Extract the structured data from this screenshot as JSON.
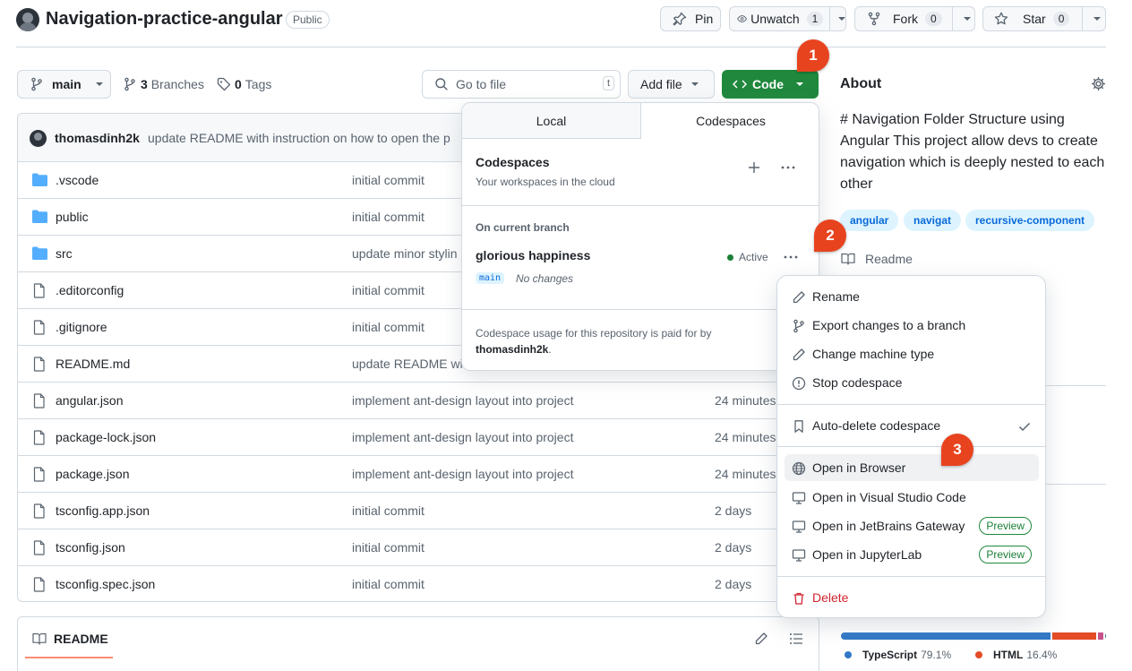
{
  "repo": {
    "name": "Navigation-practice-angular",
    "visibility": "Public"
  },
  "header_actions": {
    "pin": "Pin",
    "unwatch": "Unwatch",
    "unwatch_count": "1",
    "fork": "Fork",
    "fork_count": "0",
    "star": "Star",
    "star_count": "0"
  },
  "toolbar": {
    "branch": "main",
    "branches_count": "3",
    "branches_label": "Branches",
    "tags_count": "0",
    "tags_label": "Tags",
    "go_to_file_placeholder": "Go to file",
    "go_to_file_shortcut": "t",
    "add_file": "Add file",
    "code": "Code"
  },
  "latest_commit": {
    "author": "thomasdinh2k",
    "message": "update README with instruction on how to open the p"
  },
  "files": [
    {
      "name": ".vscode",
      "type": "folder",
      "message": "initial commit",
      "time": ""
    },
    {
      "name": "public",
      "type": "folder",
      "message": "initial commit",
      "time": ""
    },
    {
      "name": "src",
      "type": "folder",
      "message": "update minor stylin",
      "time": ""
    },
    {
      "name": ".editorconfig",
      "type": "file",
      "message": "initial commit",
      "time": ""
    },
    {
      "name": ".gitignore",
      "type": "file",
      "message": "initial commit",
      "time": ""
    },
    {
      "name": "README.md",
      "type": "file",
      "message": "update README wi",
      "time": ""
    },
    {
      "name": "angular.json",
      "type": "file",
      "message": "implement ant-design layout into project",
      "time": "24 minutes"
    },
    {
      "name": "package-lock.json",
      "type": "file",
      "message": "implement ant-design layout into project",
      "time": "24 minutes"
    },
    {
      "name": "package.json",
      "type": "file",
      "message": "implement ant-design layout into project",
      "time": "24 minutes"
    },
    {
      "name": "tsconfig.app.json",
      "type": "file",
      "message": "initial commit",
      "time": "2 days"
    },
    {
      "name": "tsconfig.json",
      "type": "file",
      "message": "initial commit",
      "time": "2 days"
    },
    {
      "name": "tsconfig.spec.json",
      "type": "file",
      "message": "initial commit",
      "time": "2 days"
    }
  ],
  "readme_header": {
    "title": "README"
  },
  "about": {
    "title": "About",
    "description": "# Navigation Folder Structure using Angular This project allow devs to create navigation which is deeply nested to each other",
    "topics": [
      "angular",
      "navigat",
      "recursive-component"
    ],
    "readme_link": "Readme"
  },
  "languages": [
    {
      "name": "TypeScript",
      "percent": "79.1%",
      "color": "#3178c6",
      "fraction": 0.791
    },
    {
      "name": "HTML",
      "percent": "16.4%",
      "color": "#e34c26",
      "fraction": 0.164
    }
  ],
  "code_popup": {
    "tab_local": "Local",
    "tab_codespaces": "Codespaces",
    "section_title": "Codespaces",
    "section_subtitle": "Your workspaces in the cloud",
    "branch_heading": "On current branch",
    "codespace_name": "glorious happiness",
    "status": "Active",
    "status_color": "#1a7f37",
    "branch_tag": "main",
    "changes": "No changes",
    "footer_text": "Codespace usage for this repository is paid for by",
    "footer_owner": "thomasdinh2k",
    "footer_end": "."
  },
  "context_menu": {
    "rename": "Rename",
    "export": "Export changes to a branch",
    "change_machine": "Change machine type",
    "stop": "Stop codespace",
    "auto_delete": "Auto-delete codespace",
    "open_browser": "Open in Browser",
    "open_vscode": "Open in Visual Studio Code",
    "open_jetbrains": "Open in JetBrains Gateway",
    "open_jupyter": "Open in JupyterLab",
    "preview": "Preview",
    "delete": "Delete",
    "delete_color": "#d1242f"
  },
  "step_badges": {
    "one": "1",
    "two": "2",
    "three": "3",
    "color": "#e8431f"
  }
}
